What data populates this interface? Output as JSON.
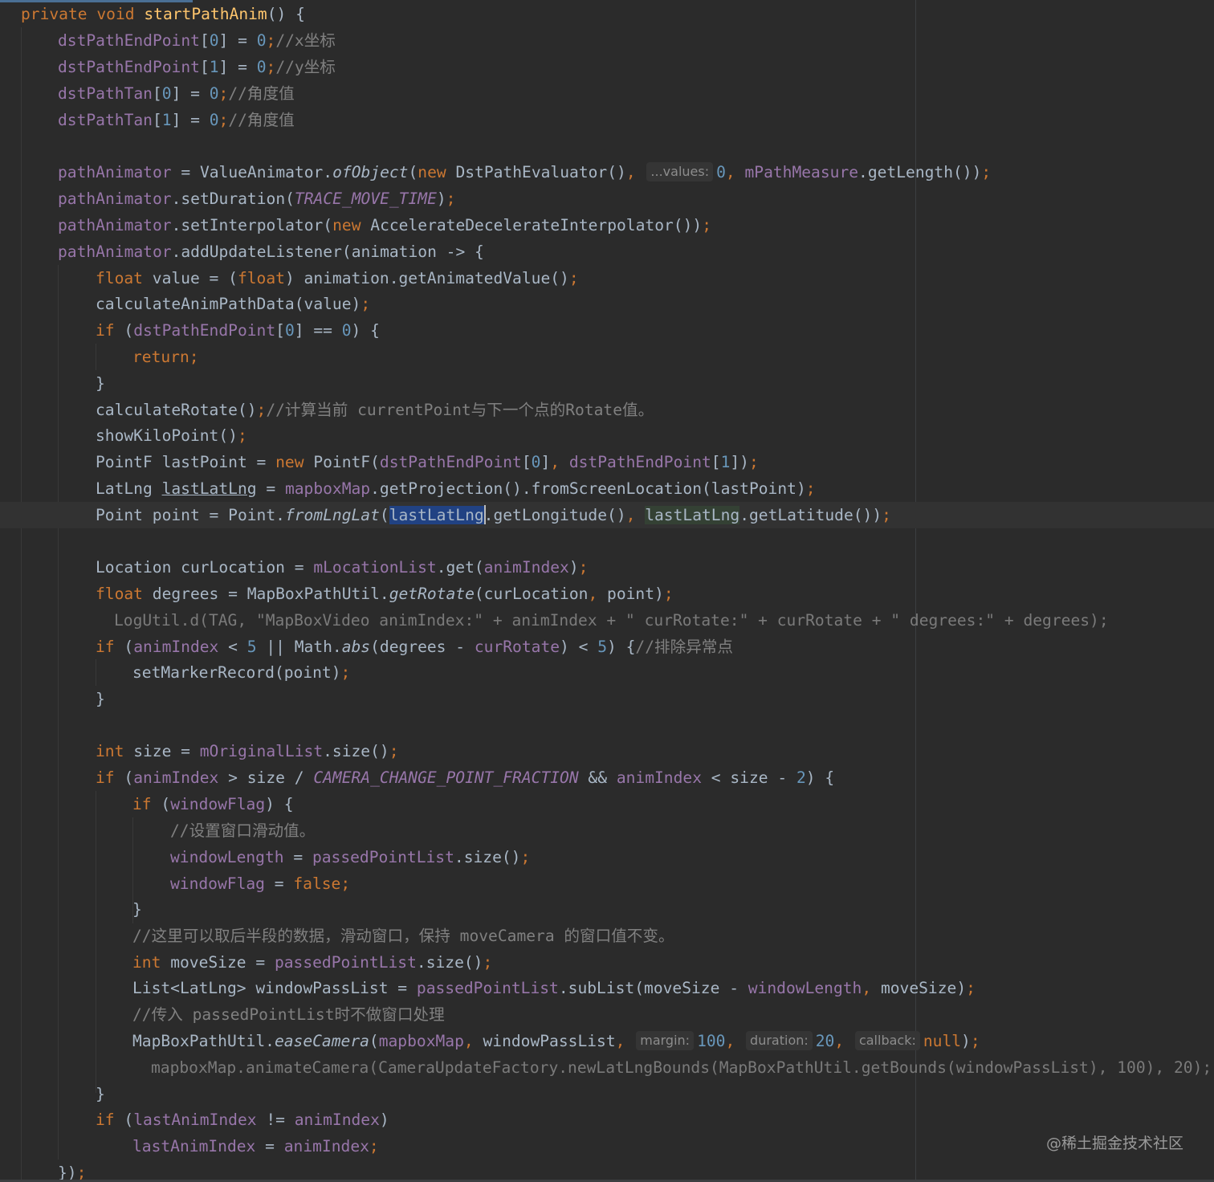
{
  "theme": {
    "background": "#2b2b2b",
    "caret_line_background": "#323232",
    "selection": "#214283",
    "colors": {
      "keyword": "#cc7832",
      "field": "#9876aa",
      "number": "#6897bb",
      "comment": "#808080",
      "string": "#6a8759",
      "italic_method": "#a9b7c6",
      "default": "#a9b7c6",
      "ghost": "#7a7a7a"
    }
  },
  "code_lines": [
    {
      "tokens": [
        [
          "private void ",
          "kw"
        ],
        [
          "startPathAnim",
          "mth"
        ],
        [
          "() {",
          "p"
        ]
      ]
    },
    {
      "tokens": [
        [
          "dstPathEndPoint",
          "fld"
        ],
        [
          "[",
          "p"
        ],
        [
          "0",
          "num"
        ],
        [
          "] = ",
          "p"
        ],
        [
          "0",
          "num"
        ],
        [
          ";",
          "kw"
        ],
        [
          "//x坐标",
          "cmt"
        ]
      ]
    },
    {
      "tokens": [
        [
          "dstPathEndPoint",
          "fld"
        ],
        [
          "[",
          "p"
        ],
        [
          "1",
          "num"
        ],
        [
          "] = ",
          "p"
        ],
        [
          "0",
          "num"
        ],
        [
          ";",
          "kw"
        ],
        [
          "//y坐标",
          "cmt"
        ]
      ]
    },
    {
      "tokens": [
        [
          "dstPathTan",
          "fld"
        ],
        [
          "[",
          "p"
        ],
        [
          "0",
          "num"
        ],
        [
          "] = ",
          "p"
        ],
        [
          "0",
          "num"
        ],
        [
          ";",
          "kw"
        ],
        [
          "//角度值",
          "cmt"
        ]
      ]
    },
    {
      "tokens": [
        [
          "dstPathTan",
          "fld"
        ],
        [
          "[",
          "p"
        ],
        [
          "1",
          "num"
        ],
        [
          "] = ",
          "p"
        ],
        [
          "0",
          "num"
        ],
        [
          ";",
          "kw"
        ],
        [
          "//角度值",
          "cmt"
        ]
      ]
    },
    {
      "tokens": []
    },
    {
      "tokens": [
        [
          "pathAnimator",
          "fld"
        ],
        [
          " = ValueAnimator.",
          "p"
        ],
        [
          "ofObject",
          "ital"
        ],
        [
          "(",
          "p"
        ],
        [
          "new ",
          "kw"
        ],
        [
          "DstPathEvaluator()",
          "p"
        ],
        [
          ", ",
          "kw"
        ],
        [
          "...values:",
          "hint"
        ],
        [
          "0",
          "num"
        ],
        [
          ", ",
          "kw"
        ],
        [
          "mPathMeasure",
          "fld"
        ],
        [
          ".getLength())",
          "p"
        ],
        [
          ";",
          "kw"
        ]
      ]
    },
    {
      "tokens": [
        [
          "pathAnimator",
          "fld"
        ],
        [
          ".setDuration(",
          "p"
        ],
        [
          "TRACE_MOVE_TIME",
          "const"
        ],
        [
          ")",
          "p"
        ],
        [
          ";",
          "kw"
        ]
      ]
    },
    {
      "tokens": [
        [
          "pathAnimator",
          "fld"
        ],
        [
          ".setInterpolator(",
          "p"
        ],
        [
          "new ",
          "kw"
        ],
        [
          "AccelerateDecelerateInterpolator())",
          "p"
        ],
        [
          ";",
          "kw"
        ]
      ]
    },
    {
      "tokens": [
        [
          "pathAnimator",
          "fld"
        ],
        [
          ".addUpdateListener(animation -> {",
          "p"
        ]
      ]
    },
    {
      "tokens": [
        [
          "float ",
          "kw"
        ],
        [
          "value = (",
          "p"
        ],
        [
          "float",
          "kw"
        ],
        [
          ") animation.getAnimatedValue()",
          "p"
        ],
        [
          ";",
          "kw"
        ]
      ]
    },
    {
      "tokens": [
        [
          "calculateAnimPathData(value)",
          "p"
        ],
        [
          ";",
          "kw"
        ]
      ]
    },
    {
      "tokens": [
        [
          "if ",
          "kw"
        ],
        [
          "(",
          "p"
        ],
        [
          "dstPathEndPoint",
          "fld"
        ],
        [
          "[",
          "p"
        ],
        [
          "0",
          "num"
        ],
        [
          "] == ",
          "p"
        ],
        [
          "0",
          "num"
        ],
        [
          ") {",
          "p"
        ]
      ]
    },
    {
      "tokens": [
        [
          "return;",
          "kw"
        ]
      ]
    },
    {
      "tokens": [
        [
          "}",
          "p"
        ]
      ]
    },
    {
      "tokens": [
        [
          "calculateRotate()",
          "p"
        ],
        [
          ";",
          "kw"
        ],
        [
          "//计算当前 currentPoint与下一个点的Rotate值。",
          "cmt"
        ]
      ]
    },
    {
      "tokens": [
        [
          "showKiloPoint()",
          "p"
        ],
        [
          ";",
          "kw"
        ]
      ]
    },
    {
      "tokens": [
        [
          "PointF lastPoint = ",
          "p"
        ],
        [
          "new ",
          "kw"
        ],
        [
          "PointF(",
          "p"
        ],
        [
          "dstPathEndPoint",
          "fld"
        ],
        [
          "[",
          "p"
        ],
        [
          "0",
          "num"
        ],
        [
          "]",
          "p"
        ],
        [
          ", ",
          "kw"
        ],
        [
          "dstPathEndPoint",
          "fld"
        ],
        [
          "[",
          "p"
        ],
        [
          "1",
          "num"
        ],
        [
          "])",
          "p"
        ],
        [
          ";",
          "kw"
        ]
      ]
    },
    {
      "tokens": [
        [
          "LatLng ",
          "p"
        ],
        [
          "lastLatLng",
          "uline"
        ],
        [
          " = ",
          "p"
        ],
        [
          "mapboxMap",
          "fld"
        ],
        [
          ".getProjection().fromScreenLocation(lastPoint)",
          "p"
        ],
        [
          ";",
          "kw"
        ]
      ]
    },
    {
      "tokens": [
        [
          "Point point = Point.",
          "p"
        ],
        [
          "fromLngLat",
          "ital"
        ],
        [
          "(",
          "p"
        ],
        [
          "lastLatLng",
          "sel"
        ],
        [
          "|",
          "caret"
        ],
        [
          ".getLongitude()",
          "p"
        ],
        [
          ", ",
          "kw"
        ],
        [
          "lastLatLng",
          "occ"
        ],
        [
          ".getLatitude())",
          "p"
        ],
        [
          ";",
          "kw"
        ]
      ]
    },
    {
      "tokens": []
    },
    {
      "tokens": [
        [
          "Location curLocation = ",
          "p"
        ],
        [
          "mLocationList",
          "fld"
        ],
        [
          ".get(",
          "p"
        ],
        [
          "animIndex",
          "fld"
        ],
        [
          ")",
          "p"
        ],
        [
          ";",
          "kw"
        ]
      ]
    },
    {
      "tokens": [
        [
          "float ",
          "kw"
        ],
        [
          "degrees = MapBoxPathUtil.",
          "p"
        ],
        [
          "getRotate",
          "ital"
        ],
        [
          "(curLocation",
          "p"
        ],
        [
          ", ",
          "kw"
        ],
        [
          "point)",
          "p"
        ],
        [
          ";",
          "kw"
        ]
      ]
    },
    {
      "tokens": [
        [
          "LogUtil.d(TAG, \"MapBoxVideo animIndex:\" + animIndex + \" curRotate:\" + curRotate + \" degrees:\" + degrees);",
          "ghost"
        ]
      ]
    },
    {
      "tokens": [
        [
          "if ",
          "kw"
        ],
        [
          "(",
          "p"
        ],
        [
          "animIndex",
          "fld"
        ],
        [
          " < ",
          "p"
        ],
        [
          "5",
          "num"
        ],
        [
          " || Math.",
          "p"
        ],
        [
          "abs",
          "ital"
        ],
        [
          "(degrees - ",
          "p"
        ],
        [
          "curRotate",
          "fld"
        ],
        [
          ") < ",
          "p"
        ],
        [
          "5",
          "num"
        ],
        [
          ") {",
          "p"
        ],
        [
          "//排除异常点",
          "cmt"
        ]
      ]
    },
    {
      "tokens": [
        [
          "setMarkerRecord(point)",
          "p"
        ],
        [
          ";",
          "kw"
        ]
      ]
    },
    {
      "tokens": [
        [
          "}",
          "p"
        ]
      ]
    },
    {
      "tokens": []
    },
    {
      "tokens": [
        [
          "int ",
          "kw"
        ],
        [
          "size = ",
          "p"
        ],
        [
          "mOriginalList",
          "fld"
        ],
        [
          ".size()",
          "p"
        ],
        [
          ";",
          "kw"
        ]
      ]
    },
    {
      "tokens": [
        [
          "if ",
          "kw"
        ],
        [
          "(",
          "p"
        ],
        [
          "animIndex",
          "fld"
        ],
        [
          " > size / ",
          "p"
        ],
        [
          "CAMERA_CHANGE_POINT_FRACTION",
          "const"
        ],
        [
          " && ",
          "p"
        ],
        [
          "animIndex",
          "fld"
        ],
        [
          " < size - ",
          "p"
        ],
        [
          "2",
          "num"
        ],
        [
          ") {",
          "p"
        ]
      ]
    },
    {
      "tokens": [
        [
          "if ",
          "kw"
        ],
        [
          "(",
          "p"
        ],
        [
          "windowFlag",
          "fld"
        ],
        [
          ") {",
          "p"
        ]
      ]
    },
    {
      "tokens": [
        [
          "//设置窗口滑动值。",
          "cmt"
        ]
      ]
    },
    {
      "tokens": [
        [
          "windowLength",
          "fld"
        ],
        [
          " = ",
          "p"
        ],
        [
          "passedPointList",
          "fld"
        ],
        [
          ".size()",
          "p"
        ],
        [
          ";",
          "kw"
        ]
      ]
    },
    {
      "tokens": [
        [
          "windowFlag",
          "fld"
        ],
        [
          " = ",
          "p"
        ],
        [
          "false;",
          "kw"
        ]
      ]
    },
    {
      "tokens": [
        [
          "}",
          "p"
        ]
      ]
    },
    {
      "tokens": [
        [
          "//这里可以取后半段的数据，滑动窗口，保持 moveCamera 的窗口值不变。",
          "cmt"
        ]
      ]
    },
    {
      "tokens": [
        [
          "int ",
          "kw"
        ],
        [
          "moveSize = ",
          "p"
        ],
        [
          "passedPointList",
          "fld"
        ],
        [
          ".size()",
          "p"
        ],
        [
          ";",
          "kw"
        ]
      ]
    },
    {
      "tokens": [
        [
          "List<LatLng> windowPassList = ",
          "p"
        ],
        [
          "passedPointList",
          "fld"
        ],
        [
          ".subList(moveSize - ",
          "p"
        ],
        [
          "windowLength",
          "fld"
        ],
        [
          ", ",
          "kw"
        ],
        [
          "moveSize)",
          "p"
        ],
        [
          ";",
          "kw"
        ]
      ]
    },
    {
      "tokens": [
        [
          "//传入 passedPointList时不做窗口处理",
          "cmt"
        ]
      ]
    },
    {
      "tokens": [
        [
          "MapBoxPathUtil.",
          "p"
        ],
        [
          "easeCamera",
          "ital"
        ],
        [
          "(",
          "p"
        ],
        [
          "mapboxMap",
          "fld"
        ],
        [
          ", ",
          "kw"
        ],
        [
          "windowPassList",
          "p"
        ],
        [
          ", ",
          "kw"
        ],
        [
          "margin:",
          "hint"
        ],
        [
          "100",
          "num"
        ],
        [
          ", ",
          "kw"
        ],
        [
          "duration:",
          "hint"
        ],
        [
          "20",
          "num"
        ],
        [
          ", ",
          "kw"
        ],
        [
          "callback:",
          "hint"
        ],
        [
          "null",
          "kw"
        ],
        [
          ")",
          "p"
        ],
        [
          ";",
          "kw"
        ]
      ]
    },
    {
      "tokens": [
        [
          "mapboxMap.animateCamera(CameraUpdateFactory.newLatLngBounds(MapBoxPathUtil.getBounds(windowPassList), 100), 20);",
          "ghost"
        ]
      ]
    },
    {
      "tokens": [
        [
          "}",
          "p"
        ]
      ]
    },
    {
      "tokens": [
        [
          "if ",
          "kw"
        ],
        [
          "(",
          "p"
        ],
        [
          "lastAnimIndex",
          "fld"
        ],
        [
          " != ",
          "p"
        ],
        [
          "animIndex",
          "fld"
        ],
        [
          ")",
          "p"
        ]
      ]
    },
    {
      "tokens": [
        [
          "lastAnimIndex",
          "fld"
        ],
        [
          " = ",
          "p"
        ],
        [
          "animIndex",
          "fld"
        ],
        [
          ";",
          "kw"
        ]
      ]
    },
    {
      "tokens": [
        [
          "})",
          "p"
        ],
        [
          ";",
          "kw"
        ]
      ]
    }
  ],
  "watermark": "@稀土掘金技术社区"
}
